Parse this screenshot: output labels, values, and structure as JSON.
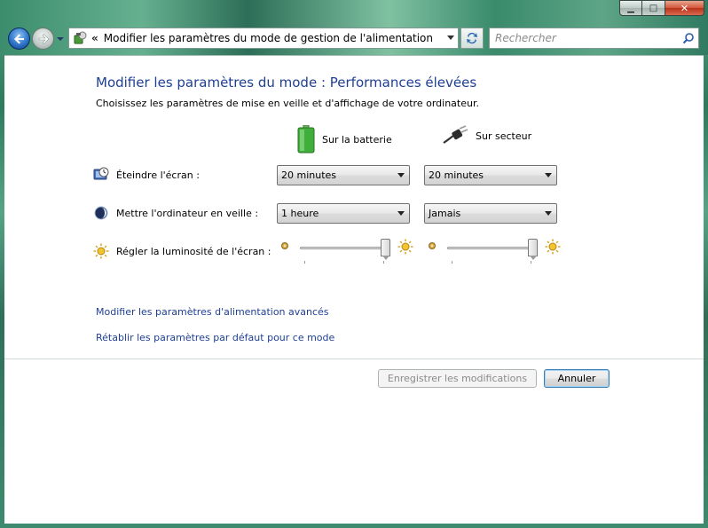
{
  "window": {
    "caption_minimize": "▁",
    "caption_maximize": "□",
    "caption_close": "✕"
  },
  "toolbar": {
    "address_chevron": "«",
    "address_text": "Modifier les paramètres du mode de gestion de l'alimentation",
    "search_placeholder": "Rechercher"
  },
  "main": {
    "title": "Modifier les paramètres du mode : Performances élevées",
    "subtitle": "Choisissez les paramètres de mise en veille et d'affichage de votre ordinateur.",
    "columns": {
      "battery": "Sur la batterie",
      "plugged": "Sur secteur"
    },
    "rows": [
      {
        "label": "Éteindre l'écran :",
        "battery_value": "20 minutes",
        "plugged_value": "20 minutes"
      },
      {
        "label": "Mettre l'ordinateur en veille :",
        "battery_value": "1 heure",
        "plugged_value": "Jamais"
      }
    ],
    "brightness": {
      "label": "Régler la luminosité de l'écran :",
      "battery_level": 1.0,
      "plugged_level": 1.0
    },
    "links": {
      "advanced": "Modifier les paramètres d'alimentation avancés",
      "restore": "Rétablir les paramètres par défaut pour ce mode"
    },
    "buttons": {
      "save": "Enregistrer les modifications",
      "cancel": "Annuler"
    }
  },
  "icons": {
    "back": "back-arrow-icon",
    "forward": "forward-arrow-icon",
    "refresh": "refresh-icon",
    "search": "magnifier-icon",
    "battery": "battery-icon",
    "plug": "power-plug-icon",
    "screen": "monitor-clock-icon",
    "sleep": "moon-icon",
    "brightness": "sun-icon"
  },
  "colors": {
    "accent": "#1e3f93",
    "battery_green": "#3fae3a"
  }
}
